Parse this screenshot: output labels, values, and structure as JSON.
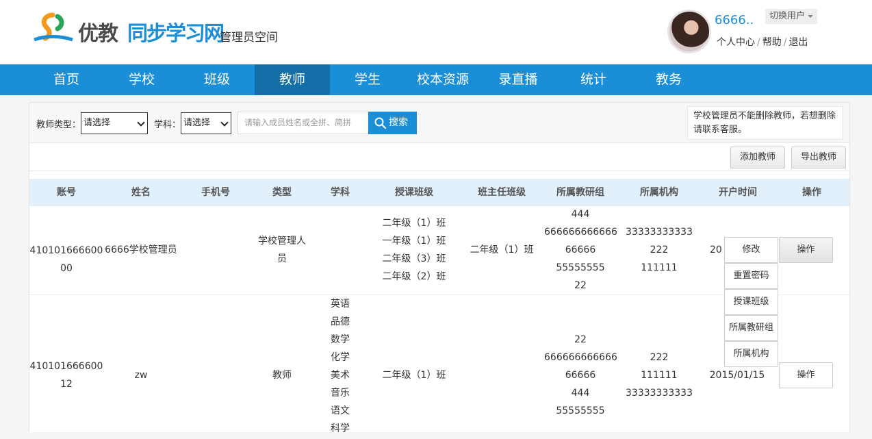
{
  "header": {
    "brand_main": "优教",
    "brand_sub": "同步学习网",
    "space_title": "管理员空间",
    "username": "6666..",
    "switch_user": "切换用户",
    "links": [
      "个人中心",
      "帮助",
      "退出"
    ]
  },
  "nav": {
    "items": [
      "首页",
      "学校",
      "班级",
      "教师",
      "学生",
      "校本资源",
      "录直播",
      "统计",
      "教务"
    ],
    "active": "教师"
  },
  "filters": {
    "teacher_type_label": "教师类型：",
    "teacher_type_value": "请选择",
    "subject_label": "学科：",
    "subject_value": "请选择",
    "search_placeholder": "请输入成员姓名或全拼、简拼",
    "search_button": "搜索",
    "notice": "学校管理员不能删除教师，若想删除请联系客服。"
  },
  "actions": {
    "add_teacher": "添加教师",
    "export_teacher": "导出教师"
  },
  "table": {
    "headers": [
      "账号",
      "姓名",
      "手机号",
      "类型",
      "学科",
      "授课班级",
      "班主任班级",
      "所属教研组",
      "所属机构",
      "开户时间",
      "操作"
    ],
    "rows": [
      {
        "account_l1": "410101666600",
        "account_l2": "00",
        "name": "6666学校管理员",
        "phone": "",
        "type_l1": "学校管理人",
        "type_l2": "员",
        "subjects": [],
        "classes": [
          "二年级（1）班",
          "一年级（1）班",
          "二年级（3）班",
          "二年级（2）班"
        ],
        "head_class": "二年级（1）班",
        "groups": [
          "444",
          "666666666666",
          "66666",
          "55555555",
          "22"
        ],
        "orgs": [
          "33333333333",
          "222",
          "111111"
        ],
        "open_time": "20",
        "op": "操作"
      },
      {
        "account_l1": "410101666600",
        "account_l2": "12",
        "name": "zw",
        "phone": "",
        "type": "教师",
        "subjects": [
          "英语",
          "品德",
          "数学",
          "化学",
          "美术",
          "音乐",
          "语文",
          "科学"
        ],
        "classes": [
          "二年级（1）班"
        ],
        "head_class": "",
        "groups": [
          "22",
          "666666666666",
          "66666",
          "444",
          "55555555"
        ],
        "orgs": [
          "222",
          "111111",
          "33333333333"
        ],
        "open_time": "2015/01/15",
        "op": "操作"
      }
    ]
  },
  "op_menu": [
    "修改",
    "重置密码",
    "授课班级",
    "所属教研组",
    "所属机构"
  ],
  "colors": {
    "primary": "#1a8fd8",
    "nav_active": "#146fa8",
    "table_header": "#e1f0fb"
  }
}
